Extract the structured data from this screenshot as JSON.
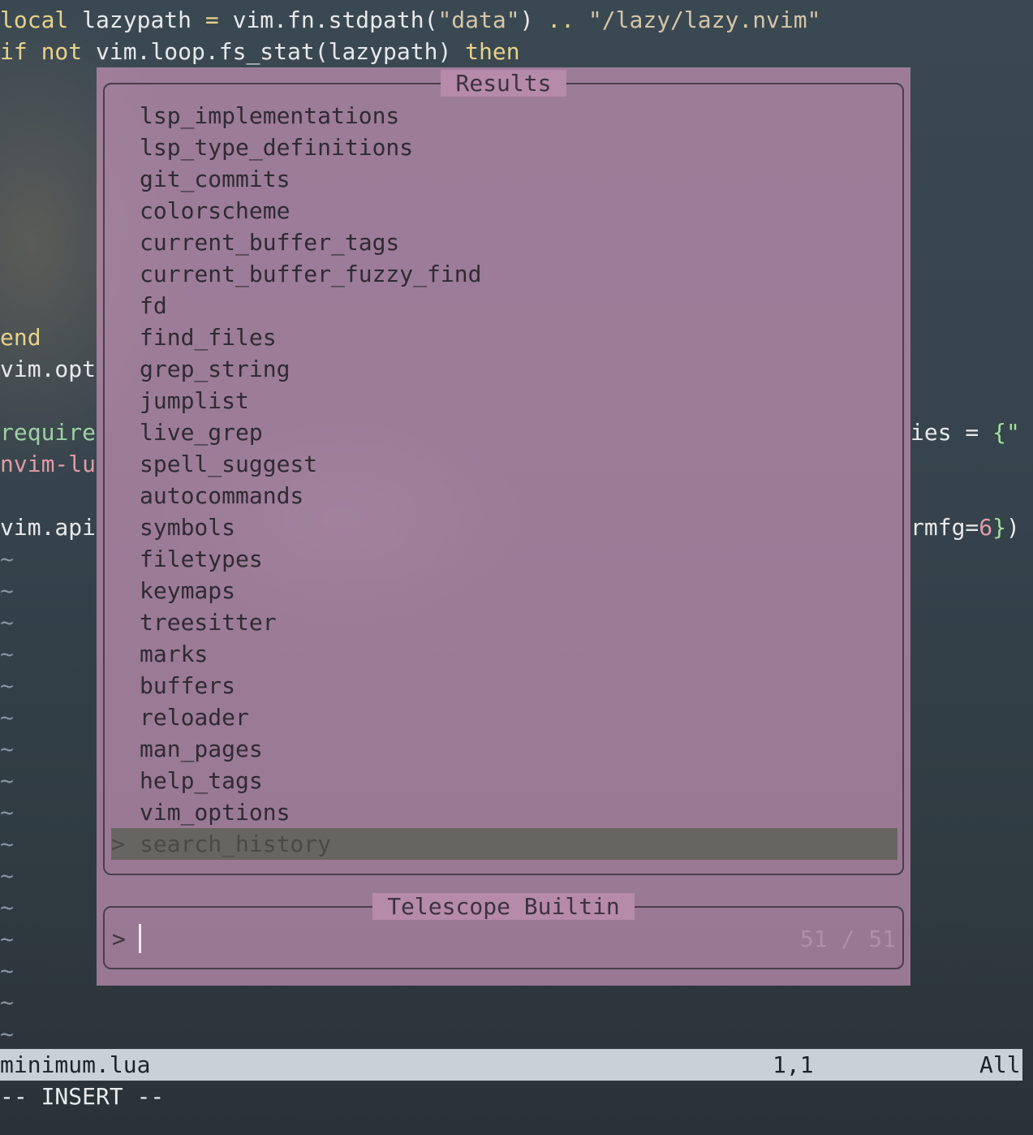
{
  "editor": {
    "line1": {
      "local": "local",
      "name": " lazypath ",
      "eq": "=",
      "call": " vim.fn.stdpath(",
      "arg": "\"data\"",
      "close": ") ",
      "concat": "..",
      "space": " ",
      "path": "\"/lazy/lazy.nvim\""
    },
    "line2": {
      "if": "if",
      "not": " not",
      "call": " vim.loop.fs_stat(lazypath) ",
      "then": "then"
    },
    "end_kw": "end",
    "vim_opt": "vim.opt",
    "require_kw": "require",
    "nvim_lu": "nvim-lu",
    "vim_api": "vim.api",
    "right_ies": "ies = ",
    "right_brace": "{\"",
    "right_rmfg": "rmfg=",
    "right_num": "6",
    "right_close_brace": "}",
    "right_paren": ")",
    "tilde": "~"
  },
  "telescope": {
    "results_title": "Results",
    "prompt_title": "Telescope Builtin",
    "prompt_prefix": ">",
    "selection_caret": ">",
    "counter": "51 / 51",
    "results": [
      "lsp_implementations",
      "lsp_type_definitions",
      "git_commits",
      "colorscheme",
      "current_buffer_tags",
      "current_buffer_fuzzy_find",
      "fd",
      "find_files",
      "grep_string",
      "jumplist",
      "live_grep",
      "spell_suggest",
      "autocommands",
      "symbols",
      "filetypes",
      "keymaps",
      "treesitter",
      "marks",
      "buffers",
      "reloader",
      "man_pages",
      "help_tags",
      "vim_options",
      "search_history"
    ],
    "selected": "search_history"
  },
  "statusline": {
    "file": "minimum.lua",
    "position": "1,1",
    "percent": "All"
  },
  "mode": "-- INSERT --"
}
